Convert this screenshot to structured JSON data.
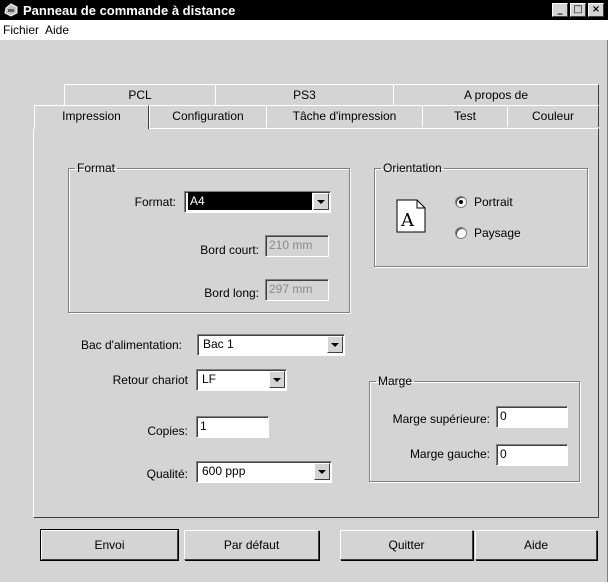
{
  "window": {
    "title": "Panneau de commande à distance",
    "buttons": {
      "minimize": "_",
      "maximize": "□",
      "close": "×"
    }
  },
  "menu": [
    "Fichier",
    "Aide"
  ],
  "tabs_back": [
    "PCL",
    "PS3",
    "A propos de"
  ],
  "tabs_front": [
    "Impression",
    "Configuration",
    "Tâche d'impression",
    "Test",
    "Couleur"
  ],
  "active_tab": "Impression",
  "format_group": {
    "legend": "Format",
    "format_label": "Format:",
    "format_value": "A4",
    "short_edge_label": "Bord court:",
    "short_edge_value": "210 mm",
    "long_edge_label": "Bord long:",
    "long_edge_value": "297 mm"
  },
  "orientation_group": {
    "legend": "Orientation",
    "icon_letter": "A",
    "options": [
      "Portrait",
      "Paysage"
    ],
    "selected": "Portrait"
  },
  "tray": {
    "label": "Bac d'alimentation:",
    "value": "Bac 1"
  },
  "carriage_return": {
    "label": "Retour chariot",
    "value": "LF"
  },
  "copies": {
    "label": "Copies:",
    "value": "1"
  },
  "quality": {
    "label": "Qualité:",
    "value": "600 ppp"
  },
  "margin_group": {
    "legend": "Marge",
    "top_label": "Marge supérieure:",
    "top_value": "0",
    "left_label": "Marge gauche:",
    "left_value": "0"
  },
  "buttons": {
    "send": "Envoi",
    "default": "Par défaut",
    "quit": "Quitter",
    "help": "Aide"
  }
}
